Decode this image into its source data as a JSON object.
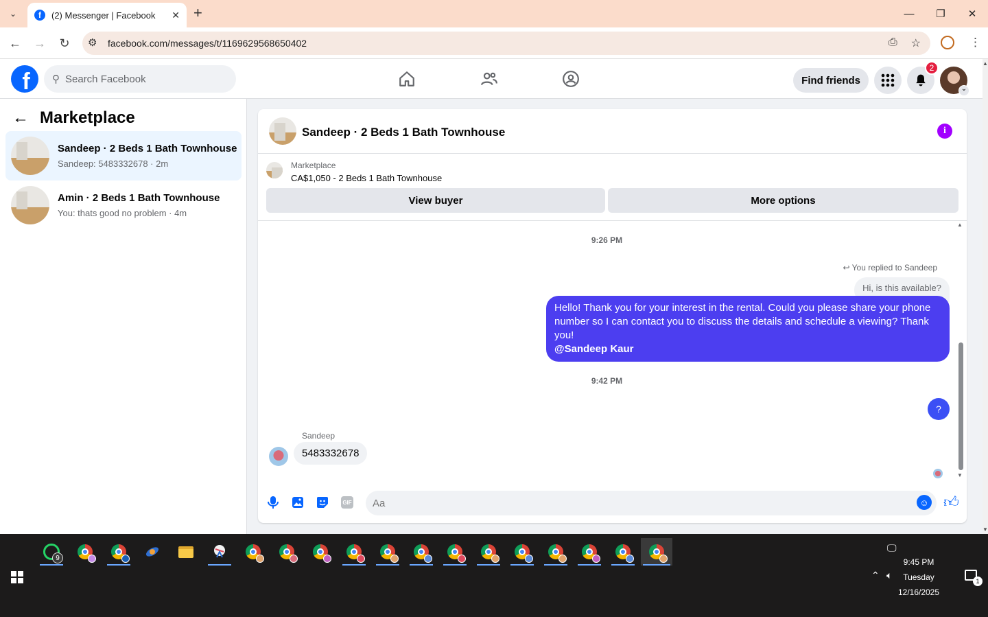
{
  "browser": {
    "tab_title": "(2) Messenger | Facebook",
    "url": "facebook.com/messages/t/1169629568650402"
  },
  "header": {
    "search_placeholder": "Search Facebook",
    "find_friends": "Find friends",
    "notification_count": "2"
  },
  "sidebar": {
    "title": "Marketplace",
    "conversations": [
      {
        "name": "Sandeep · 2 Beds 1 Bath Townhouse",
        "preview": "Sandeep: 5483332678 · 2m",
        "active": true
      },
      {
        "name": "Amin · 2 Beds 1 Bath Townhouse",
        "preview": "You: thats good no problem · 4m",
        "active": false
      }
    ]
  },
  "chat": {
    "title": "Sandeep · 2 Beds 1 Bath Townhouse",
    "marketplace_label": "Marketplace",
    "listing": "CA$1,050 - 2 Beds 1 Bath Townhouse",
    "view_buyer": "View buyer",
    "more_options": "More options",
    "messages": {
      "time1": "9:26 PM",
      "replied_label": "You replied to Sandeep",
      "replied_quote": "Hi, is this available?",
      "outgoing_text": "Hello! Thank you for your interest in the rental. Could you please share your phone number so I can contact you to discuss the details and schedule a viewing? Thank you!",
      "outgoing_mention": "@Sandeep Kaur",
      "time2": "9:42 PM",
      "outgoing_short": "?",
      "sender_name": "Sandeep",
      "incoming_text": "5483332678"
    },
    "composer_placeholder": "Aa"
  },
  "taskbar": {
    "whatsapp_badge": "9",
    "time": "9:45 PM",
    "day": "Tuesday",
    "date": "12/16/2025",
    "notification_badge": "1"
  }
}
